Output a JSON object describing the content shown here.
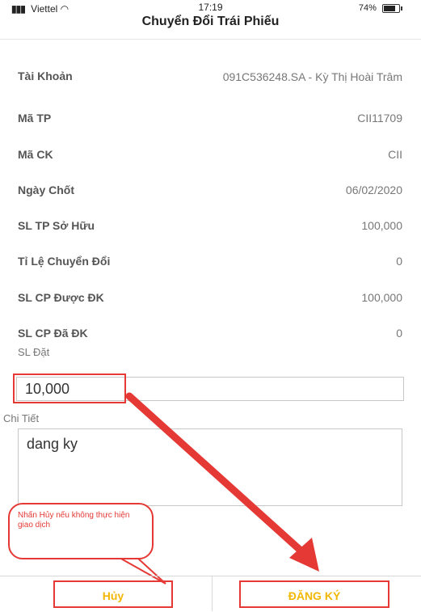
{
  "status_bar": {
    "carrier": "Viettel",
    "time": "17:19",
    "battery": "74%"
  },
  "header": {
    "title": "Chuyển Đổi Trái Phiếu"
  },
  "details": [
    {
      "label": "Tài Khoản",
      "value": "091C536248.SA - Kỳ Thị Hoài Trâm"
    },
    {
      "label": "Mã TP",
      "value": "CII11709"
    },
    {
      "label": "Mã CK",
      "value": "CII"
    },
    {
      "label": "Ngày Chốt",
      "value": "06/02/2020"
    },
    {
      "label": "SL TP Sở Hữu",
      "value": "100,000"
    },
    {
      "label": "Tỉ Lệ Chuyển Đổi",
      "value": "0"
    },
    {
      "label": "SL CP Được ĐK",
      "value": "100,000"
    },
    {
      "label": "SL CP Đã ĐK",
      "value": "0"
    }
  ],
  "form": {
    "quantity_label": "SL Đặt",
    "quantity_value": "10,000",
    "detail_label": "Chi Tiết",
    "detail_value": "dang ky"
  },
  "callout": {
    "text": "Nhấn Hủy nếu không thực hiện giao dịch"
  },
  "buttons": {
    "cancel": "Hủy",
    "register": "ĐĂNG KÝ"
  },
  "colors": {
    "highlight": "#e53935",
    "button_text": "#f2b705"
  }
}
